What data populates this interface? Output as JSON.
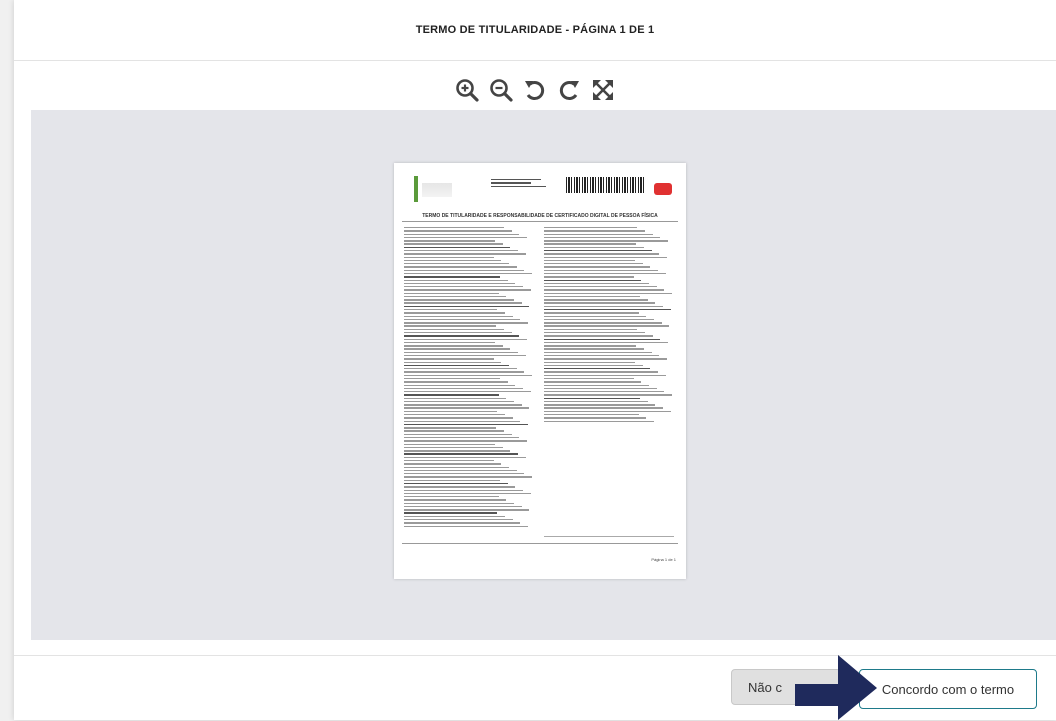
{
  "modal": {
    "title": "TERMO DE TITULARIDADE - PÁGINA 1 DE 1"
  },
  "toolbar": {
    "icons": [
      "zoom-in-icon",
      "zoom-out-icon",
      "rotate-left-icon",
      "rotate-right-icon",
      "fullscreen-icon"
    ]
  },
  "document": {
    "heading": "TERMO DE TITULARIDADE E RESPONSABILIDADE DE CERTIFICADO DIGITAL DE PESSOA FÍSICA",
    "page_label": "Página 1 de 1"
  },
  "footer": {
    "decline_label": "Não c",
    "accept_label": "Concordo com o termo"
  },
  "colors": {
    "accent": "#1e7a8a",
    "arrow": "#1f2a5c",
    "viewer_bg": "#e4e5ea"
  }
}
